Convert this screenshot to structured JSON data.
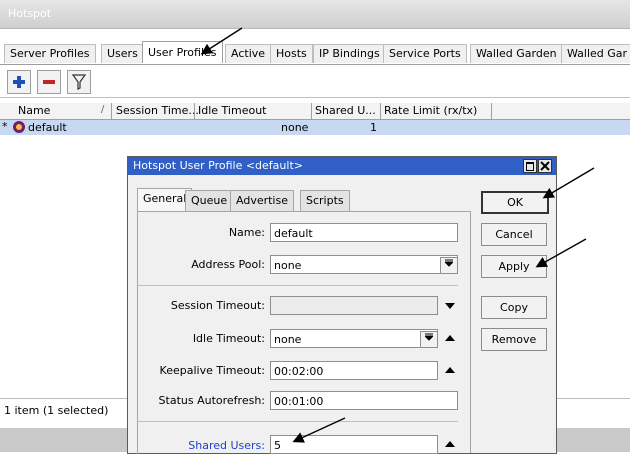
{
  "window": {
    "title": "Hotspot"
  },
  "tabs": [
    "Server Profiles",
    "Users",
    "User Profiles",
    "Active",
    "Hosts",
    "IP Bindings",
    "Service Ports",
    "Walled Garden",
    "Walled Gar"
  ],
  "columns": [
    "Name",
    "Session Time...",
    "Idle Timeout",
    "Shared U...",
    "Rate Limit (rx/tx)"
  ],
  "sort_indicator": "/",
  "row": {
    "marker": "*",
    "name": "default",
    "idle_timeout": "none",
    "shared_users": "1"
  },
  "status_text": "1 item (1 selected)",
  "dialog": {
    "title": "Hotspot User Profile <default>",
    "tabs": [
      "General",
      "Queue",
      "Advertise",
      "Scripts"
    ],
    "fields": {
      "name_label": "Name:",
      "name_value": "default",
      "address_pool_label": "Address Pool:",
      "address_pool_value": "none",
      "session_timeout_label": "Session Timeout:",
      "session_timeout_value": "",
      "idle_timeout_label": "Idle Timeout:",
      "idle_timeout_value": "none",
      "keepalive_label": "Keepalive Timeout:",
      "keepalive_value": "00:02:00",
      "status_autorefresh_label": "Status Autorefresh:",
      "status_autorefresh_value": "00:01:00",
      "shared_users_label": "Shared Users:",
      "shared_users_value": "5"
    },
    "buttons": {
      "ok": "OK",
      "cancel": "Cancel",
      "apply": "Apply",
      "copy": "Copy",
      "remove": "Remove"
    },
    "shared_users_label_color": "#1f3fd1"
  }
}
